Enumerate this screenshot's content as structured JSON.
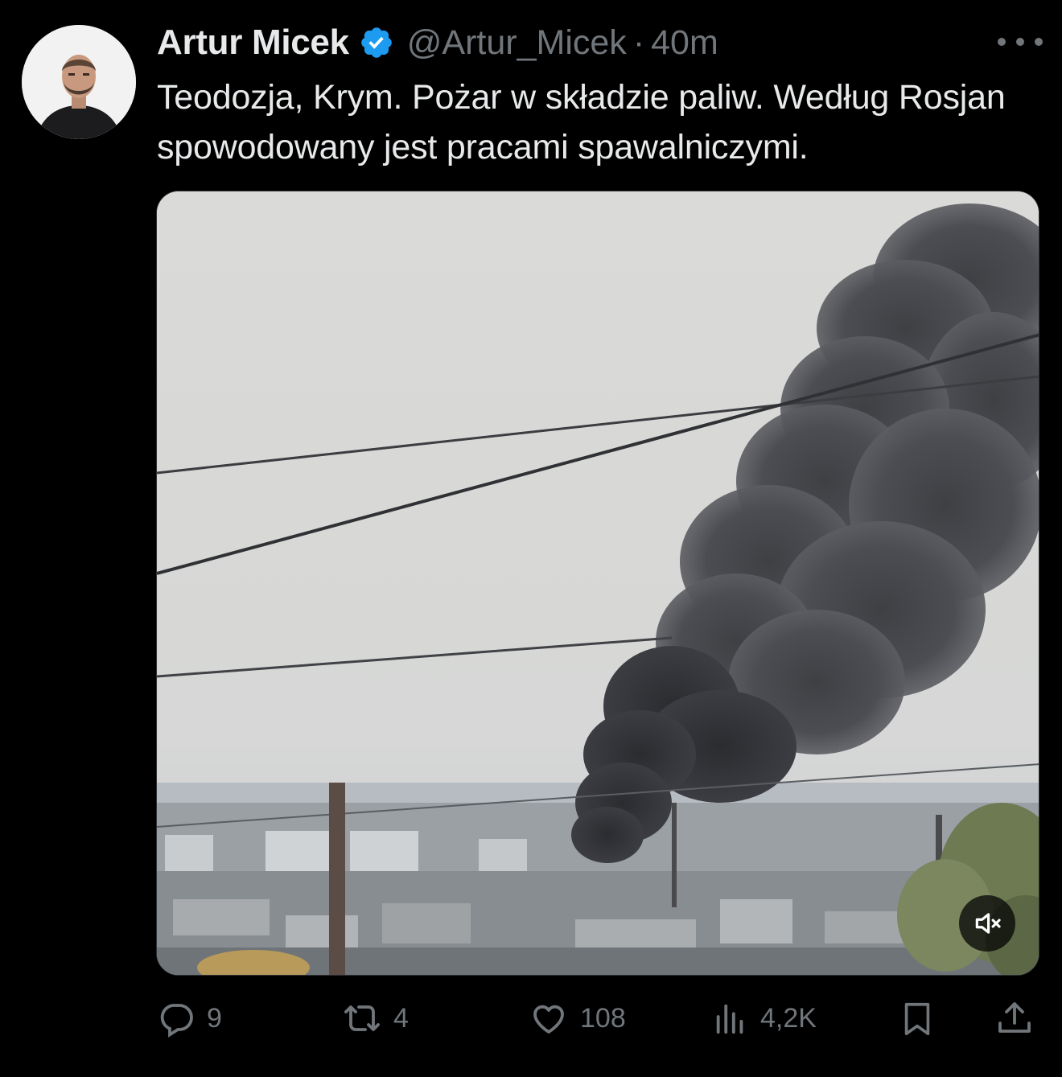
{
  "author": {
    "name": "Artur Micek",
    "handle": "@Artur_Micek",
    "separator": "·",
    "time": "40m",
    "verified_color": "#1d9bf0"
  },
  "tweet": {
    "text": "Teodozja, Krym. Pożar w składzie paliw. Według Rosjan spowodowany jest pracami spawalniczymi."
  },
  "media": {
    "type": "video",
    "muted": true,
    "mute_icon": "speaker-muted-icon"
  },
  "actions": {
    "reply": {
      "icon": "reply-icon",
      "count": "9"
    },
    "retweet": {
      "icon": "retweet-icon",
      "count": "4"
    },
    "like": {
      "icon": "heart-icon",
      "count": "108"
    },
    "views": {
      "icon": "views-icon",
      "count": "4,2K"
    },
    "bookmark": {
      "icon": "bookmark-icon"
    },
    "share": {
      "icon": "share-icon"
    }
  },
  "colors": {
    "background": "#000000",
    "text_primary": "#e7e9ea",
    "text_secondary": "#71767b",
    "accent": "#1d9bf0"
  }
}
